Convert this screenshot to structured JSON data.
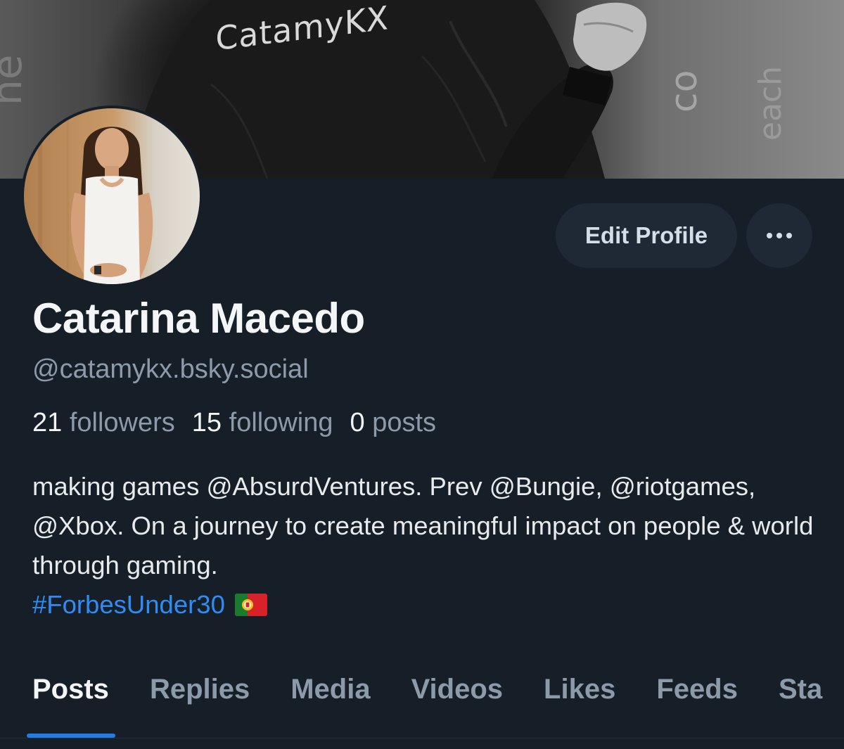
{
  "banner": {
    "wordmark": "CatamyKX"
  },
  "profile": {
    "name": "Catarina Macedo",
    "handle": "@catamykx.bsky.social"
  },
  "actions": {
    "edit_label": "Edit Profile",
    "more_icon": "ellipsis-icon"
  },
  "stats": [
    {
      "number": "21",
      "label": "followers"
    },
    {
      "number": "15",
      "label": "following"
    },
    {
      "number": "0",
      "label": "posts"
    }
  ],
  "bio": {
    "text": "making games @AbsurdVentures. Prev @Bungie, @riotgames, @Xbox. On a journey to create meaningful impact on people & world through gaming.",
    "hashtag": "#ForbesUnder30",
    "flag_icon": "portugal-flag-icon"
  },
  "tabs": [
    {
      "label": "Posts",
      "active": true
    },
    {
      "label": "Replies",
      "active": false
    },
    {
      "label": "Media",
      "active": false
    },
    {
      "label": "Videos",
      "active": false
    },
    {
      "label": "Likes",
      "active": false
    },
    {
      "label": "Feeds",
      "active": false
    },
    {
      "label": "Sta",
      "active": false
    }
  ],
  "colors": {
    "background": "#161e27",
    "accent": "#1f7de6",
    "hashtag": "#2f8cf5",
    "muted": "#8c9aa9",
    "button_bg": "#1e2935"
  }
}
